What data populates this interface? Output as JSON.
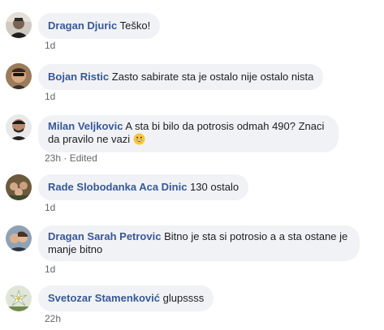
{
  "comments": [
    {
      "author": "Dragan Djuric",
      "text": "Teško!",
      "time": "1d",
      "edited": ""
    },
    {
      "author": "Bojan Ristic",
      "text": "Zasto sabirate sta je ostalo nije ostalo nista",
      "time": "1d",
      "edited": ""
    },
    {
      "author": "Milan Veljkovic",
      "text": "A sta bi bilo da potrosis odmah 490? Znaci da pravilo ne vazi",
      "emoji": "grinning-face-emoji",
      "time": "23h",
      "edited": "Edited"
    },
    {
      "author": "Rade Slobodanka Aca Dinic",
      "text": "130 ostalo",
      "time": "1d",
      "edited": ""
    },
    {
      "author": "Dragan Sarah Petrovic",
      "text": "Bitno je sta si potrosio a a sta ostane je manje bitno",
      "time": "1d",
      "edited": ""
    },
    {
      "author": "Svetozar Stamenković",
      "text": "glupssss",
      "time": "22h",
      "edited": ""
    }
  ],
  "colors": {
    "author": "#385898",
    "bubble": "#f0f2f5",
    "meta": "#65676b",
    "text": "#1c1e21"
  },
  "separator": "·"
}
